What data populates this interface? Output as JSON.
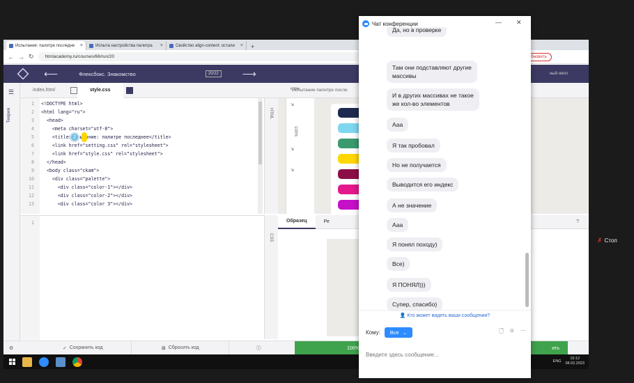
{
  "browser": {
    "tabs": [
      {
        "label": "Испытание: палитре последне"
      },
      {
        "label": "Испыта настройства палитра"
      },
      {
        "label": "Свойство align-content: остали"
      }
    ],
    "new_tab": "+",
    "url": "htmlacademy.ru/courses/66/run/20",
    "profile": "Обновить"
  },
  "app": {
    "course_title": "Флексбокс. Знакомство",
    "progress": "20/22",
    "right_text": "ный ниол"
  },
  "rail": {
    "theory": "Теория"
  },
  "editor": {
    "tabs": [
      {
        "label": "index.html"
      },
      {
        "label": "style.css"
      }
    ],
    "lines": [
      {
        "n": "1",
        "t": "<!DOCTYPE html>"
      },
      {
        "n": "2",
        "t": "<html lang=\"ru\">"
      },
      {
        "n": "3",
        "t": "  <head>"
      },
      {
        "n": "4",
        "t": "    <meta charset=\"utf-8\">"
      },
      {
        "n": "5",
        "t": "    <title>Испытание: палитре последнее</title>"
      },
      {
        "n": "6",
        "t": "    <link href=\"setting.css\" rel=\"stylesheet\">"
      },
      {
        "n": "7",
        "t": "    <link href=\"style.css\" rel=\"stylesheet\">"
      },
      {
        "n": "8",
        "t": "  </head>"
      },
      {
        "n": "9",
        "t": "  <body class=\"ckam\">"
      },
      {
        "n": "10",
        "t": "    <div class=\"palette\">"
      },
      {
        "n": "11",
        "t": "      <div class=\"color-1\"></div>"
      },
      {
        "n": "12",
        "t": "      <div class=\"color-2\"></div>"
      },
      {
        "n": "13",
        "t": "      <div class=\"color 3\"></div>"
      }
    ],
    "css_line": "1",
    "html_vert": "HTML",
    "css_vert": "CSS"
  },
  "preview": {
    "head": "Испытание палитре после",
    "right_label": "итре",
    "zoom": "100%",
    "swatches": [
      "#1d2a4f",
      "#7fd6ef",
      "#3a9a6e",
      "#ffd600",
      "#8b0f46",
      "#e5178c",
      "#c510c8"
    ]
  },
  "sample": {
    "tabs": [
      {
        "label": "Образец"
      },
      {
        "label": "Ре"
      }
    ],
    "help": "?",
    "badge": "2"
  },
  "footer": {
    "save": "Сохранить код",
    "reset": "Сбросить код",
    "progress": "100%",
    "next": "ить"
  },
  "taskbar": {
    "lang": "ENG",
    "time": "15:12",
    "date": "08.02.2023"
  },
  "stop": {
    "label": "Стоп"
  },
  "chat": {
    "title": "Чат конференции",
    "messages": [
      "Да, но в проверке",
      "Там они подставляют другие\nмассивы",
      "И в других массивах не такое\nже кол-во элементов",
      "Ааа",
      "Я так пробовал",
      "Но не получается",
      "Выводится его индекс",
      "А не значение",
      "Ааа",
      "Я понял походу)",
      "Все)",
      "Я ПОНЯЛ)))",
      "Супер, спасибо)"
    ],
    "who_sees": "Кто может видеть ваши сообщения?",
    "to_label": "Кому:",
    "to_value": "Все",
    "placeholder": "Введите здесь сообщение..."
  }
}
